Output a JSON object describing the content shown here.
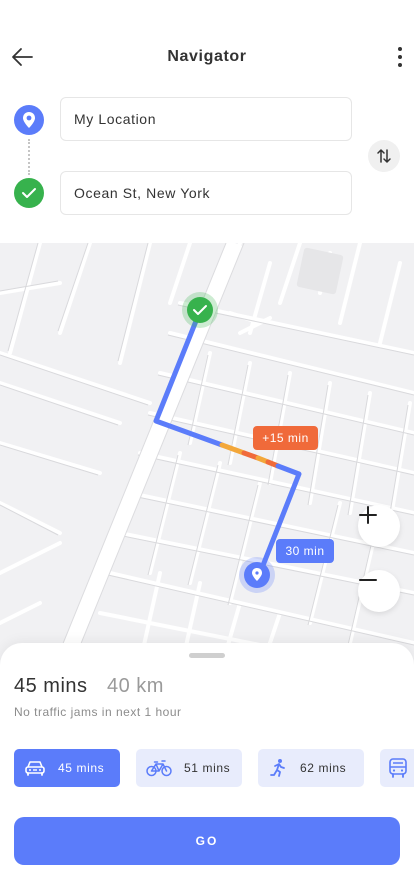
{
  "header": {
    "title": "Navigator",
    "back_icon": "arrow-left-icon",
    "menu_icon": "more-vertical-icon"
  },
  "route": {
    "from_value": "My Location",
    "from_icon": "location-pin-icon",
    "to_value": "Ocean St, New York",
    "to_icon": "check-circle-icon",
    "swap_icon": "swap-vertical-icon"
  },
  "map": {
    "traffic_delay_label": "+15 min",
    "eta_label": "30 min",
    "zoom_in_icon": "plus-icon",
    "zoom_out_icon": "minus-icon"
  },
  "summary": {
    "duration": "45 mins",
    "distance": "40 km",
    "traffic_note": "No traffic jams in next 1 hour"
  },
  "modes": [
    {
      "id": "car",
      "icon": "car-icon",
      "label": "45 mins",
      "active": true
    },
    {
      "id": "bike",
      "icon": "bicycle-icon",
      "label": "51 mins",
      "active": false
    },
    {
      "id": "walk",
      "icon": "walking-icon",
      "label": "62 mins",
      "active": false
    },
    {
      "id": "bus",
      "icon": "bus-icon",
      "label": "",
      "active": false
    }
  ],
  "actions": {
    "go_label": "GO"
  },
  "colors": {
    "accent": "#5b7cfa",
    "success": "#37b24d",
    "traffic": "#f06a3a",
    "traffic_light": "#f3a73a",
    "mode_inactive_bg": "#e8ecfc"
  }
}
